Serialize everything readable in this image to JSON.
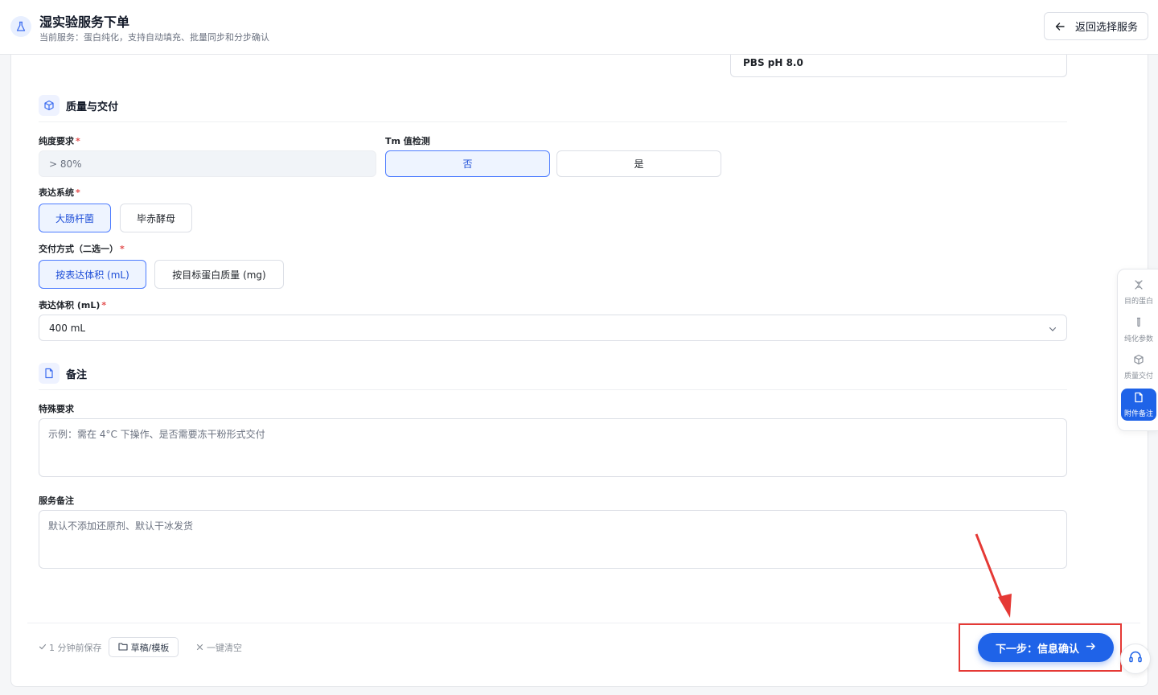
{
  "header": {
    "title": "湿实验服务下单",
    "subtitle": "当前服务：蛋白纯化，支持自动填充、批量同步和分步确认",
    "back_label": "返回选择服务"
  },
  "buffer_value": "PBS pH 8.0",
  "quality": {
    "section_title": "质量与交付",
    "purity_label": "纯度要求",
    "purity_value": "> 80%",
    "tm_label": "Tm 值检测",
    "tm_options": [
      "否",
      "是"
    ],
    "tm_selected": "否",
    "expression_label": "表达系统",
    "expression_options": [
      "大肠杆菌",
      "毕赤酵母"
    ],
    "expression_selected": "大肠杆菌",
    "delivery_label": "交付方式（二选一）",
    "delivery_options": [
      "按表达体积 (mL)",
      "按目标蛋白质量 (mg)"
    ],
    "delivery_selected": "按表达体积 (mL)",
    "volume_label": "表达体积 (mL)",
    "volume_value": "400 mL"
  },
  "notes": {
    "section_title": "备注",
    "special_label": "特殊要求",
    "special_placeholder": "示例：需在 4°C 下操作、是否需要冻干粉形式交付",
    "service_label": "服务备注",
    "service_value": "默认不添加还原剂、默认干冰发货"
  },
  "footer": {
    "saved_text": "1 分钟前保存",
    "draft_label": "草稿/模板",
    "clear_label": "一键清空",
    "next_label": "下一步：信息确认"
  },
  "side_nav": [
    {
      "label": "目的蛋白",
      "icon": "dna-icon"
    },
    {
      "label": "纯化参数",
      "icon": "test-tube-icon"
    },
    {
      "label": "质量交付",
      "icon": "box-icon"
    },
    {
      "label": "附件备注",
      "icon": "file-icon",
      "active": true
    }
  ],
  "colors": {
    "primary": "#1f63e8",
    "required": "#e34d4d",
    "highlight": "#e53935"
  }
}
